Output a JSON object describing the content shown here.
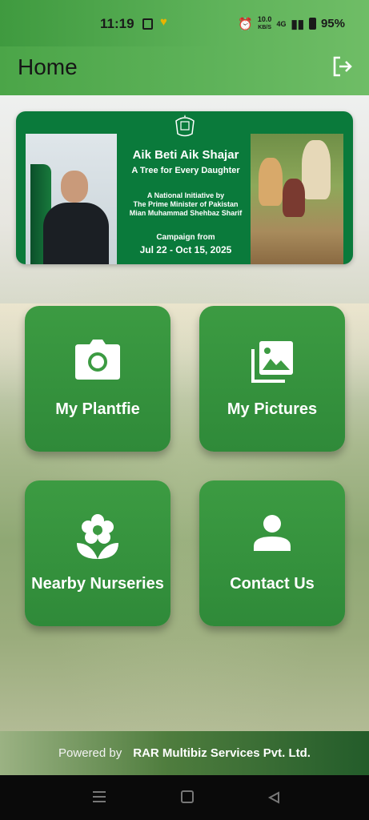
{
  "status_bar": {
    "time": "11:19",
    "network_speed_value": "10.0",
    "network_speed_unit": "KB/S",
    "signal": "4G",
    "battery": "95%"
  },
  "app_bar": {
    "title": "Home",
    "logout_icon": "logout-icon"
  },
  "banner": {
    "title": "Aik Beti Aik Shajar",
    "subtitle": "A Tree for Every Daughter",
    "line1": "A National Initiative by",
    "line2": "The Prime Minister of Pakistan",
    "line3": "Mian Muhammad Shehbaz Sharif",
    "campaign_label": "Campaign from",
    "campaign_dates": "Jul 22 - Oct 15, 2025"
  },
  "tiles": [
    {
      "label": "My Plantfie",
      "icon": "camera-icon"
    },
    {
      "label": "My Pictures",
      "icon": "gallery-icon"
    },
    {
      "label": "Nearby Nurseries",
      "icon": "flower-icon"
    },
    {
      "label": "Contact Us",
      "icon": "person-icon"
    }
  ],
  "footer": {
    "prefix": "Powered by",
    "company": "RAR Multibiz Services Pvt. Ltd."
  },
  "colors": {
    "primary_green": "#3c9b42",
    "banner_green": "#0a7a3b"
  }
}
